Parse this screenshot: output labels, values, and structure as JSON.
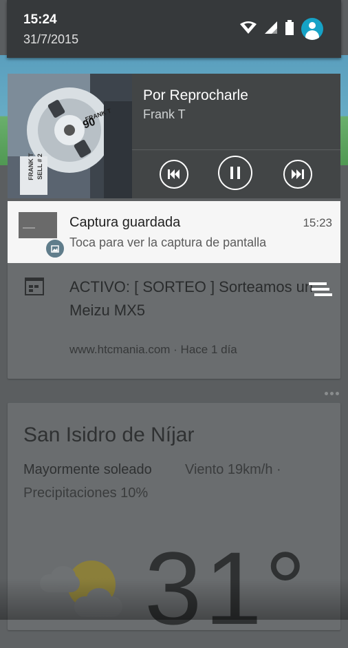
{
  "status_bar": {
    "time": "15:24",
    "date": "31/7/2015",
    "icons": [
      "wifi-icon",
      "signal-icon",
      "battery-icon",
      "user-avatar-icon"
    ],
    "accent_color": "#16a2c6"
  },
  "media_notification": {
    "song_title": "Por Reprocharle",
    "artist": "Frank T",
    "album_art_text": [
      "FRANK T",
      "90",
      "FRANK T",
      "SELL # 2"
    ],
    "controls": [
      "previous-icon",
      "pause-icon",
      "next-icon"
    ]
  },
  "screenshot_notification": {
    "title": "Captura guardada",
    "time": "15:23",
    "text": "Toca para ver la captura de pantalla"
  },
  "news_card": {
    "headline": "ACTIVO: [ SORTEO ] Sorteamos un Meizu MX5",
    "source": "www.htcmania.com · Hace 1 día"
  },
  "weather_card": {
    "city": "San Isidro de Níjar",
    "condition": "Mayormente soleado",
    "wind": "Viento 19km/h ·",
    "precipitation": "Precipitaciones 10%",
    "temperature": "31°"
  }
}
